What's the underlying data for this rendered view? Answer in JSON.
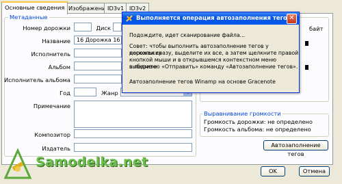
{
  "tabs": [
    {
      "label": "Основные сведения"
    },
    {
      "label": "Изображение"
    },
    {
      "label": "ID3v1"
    },
    {
      "label": "ID3v2"
    }
  ],
  "metadata": {
    "legend": "Метаданные",
    "track_label": "Номер дорожки",
    "track_value": "",
    "disc_label": "Диск",
    "disc_value": "",
    "title_label": "Название",
    "title_value": "16 Дорожка 16",
    "artist_label": "Исполнитель",
    "artist_value": "",
    "album_label": "Альбом",
    "album_value": "",
    "album_artist_label": "Исполнитель альбома",
    "album_artist_value": "",
    "year_label": "Год",
    "year_value": "",
    "genre_label": "Жанр",
    "genre_value": "",
    "comment_label": "Примечание",
    "comment_value": "",
    "composer_label": "Композитор",
    "composer_value": "",
    "publisher_label": "Издатель",
    "publisher_value": ""
  },
  "right_panel": {
    "partial_label": "байт"
  },
  "volume": {
    "legend": "Выравнивание громкости",
    "track_gain": "Громкость дорожки: не определено",
    "album_gain": "Громкость альбома: не определено"
  },
  "buttons": {
    "autotag": "Автозаполнение тегов",
    "ok": "OK",
    "cancel": "Отмена"
  },
  "dialog": {
    "title": "Выполняется операция автозаполнения тегов",
    "line1": "Подождите, идет сканирование файла...",
    "tip1": "Совет: чтобы выполнить автозаполнение тегов у нескольких",
    "tip2": "дорожек сразу, выделите их все, а затем щелкните правой",
    "tip3": "кнопкой мыши и в открывшемся контекстном меню выберите",
    "tip4": "в подменю «Отправить» команду «Автозаполнение тегов».",
    "footer": "Автозаполнение тегов Winamp на основе Gracenote"
  },
  "watermark": {
    "text": "Samodelka.net"
  }
}
